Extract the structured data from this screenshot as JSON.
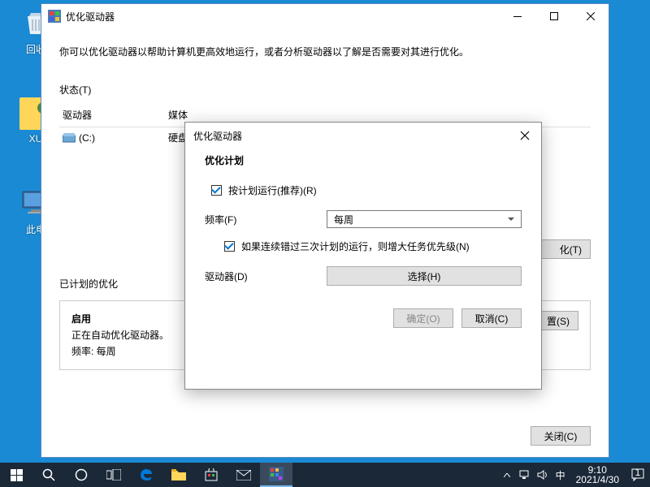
{
  "desktop": {
    "recycle": "回收",
    "user": "XU",
    "pc": "此电"
  },
  "win1": {
    "title": "优化驱动器",
    "intro": "你可以优化驱动器以帮助计算机更高效地运行，或者分析驱动器以了解是否需要对其进行优化。",
    "status_label": "状态(T)",
    "col_drive": "驱动器",
    "col_media": "媒体",
    "row_drive": "(C:)",
    "row_media": "硬盘",
    "btn_analyze_cut": "化(T)",
    "btn_settings_cut": "置(S)",
    "sched_heading": "已计划的优化",
    "sched_status": "启用",
    "sched_desc": "正在自动优化驱动器。",
    "sched_freq": "频率: 每周",
    "btn_close": "关闭(C)"
  },
  "win2": {
    "title": "优化驱动器",
    "heading": "优化计划",
    "chk_run": "按计划运行(推荐)(R)",
    "freq_label": "频率(F)",
    "freq_value": "每周",
    "chk_priority": "如果连续错过三次计划的运行，则增大任务优先级(N)",
    "drives_label": "驱动器(D)",
    "btn_choose": "选择(H)",
    "btn_ok": "确定(O)",
    "btn_cancel": "取消(C)"
  },
  "tray": {
    "ime": "中",
    "time": "9:10",
    "date": "2021/4/30"
  }
}
